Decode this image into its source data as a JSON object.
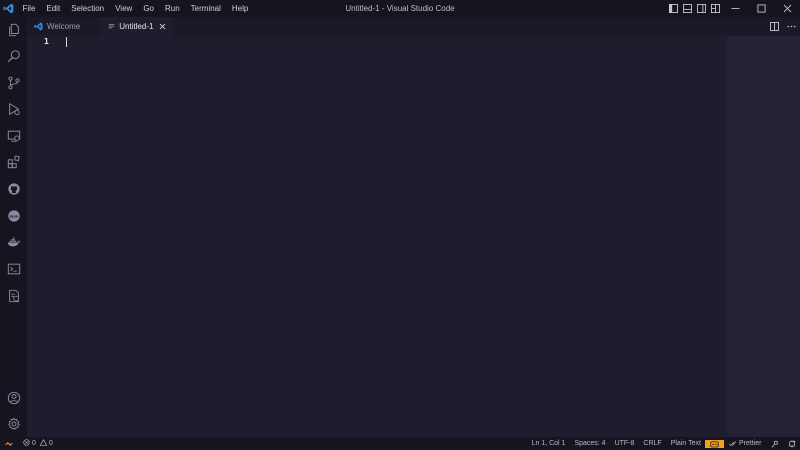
{
  "window": {
    "title": "Untitled-1 - Visual Studio Code"
  },
  "menu": {
    "items": [
      "File",
      "Edit",
      "Selection",
      "View",
      "Go",
      "Run",
      "Terminal",
      "Help"
    ]
  },
  "activity_bar": {
    "items": [
      "explorer-icon",
      "search-icon",
      "source-control-icon",
      "run-debug-icon",
      "remote-explorer-icon",
      "extensions-icon",
      "github-icon",
      "json-icon",
      "docker-icon",
      "terminal-icon",
      "test-report-icon"
    ],
    "bottom": [
      "account-icon",
      "settings-gear-icon"
    ]
  },
  "tabs": [
    {
      "label": "Welcome",
      "icon": "vscode-logo-icon",
      "active": false
    },
    {
      "label": "Untitled-1",
      "icon": "file-lines-icon",
      "active": true
    }
  ],
  "editor": {
    "line_numbers": [
      "1"
    ],
    "content": ""
  },
  "statusbar": {
    "errors": "0",
    "warnings": "0",
    "cursor_position": "Ln 1, Col 1",
    "indentation": "Spaces: 4",
    "encoding": "UTF-8",
    "eol": "CRLF",
    "language": "Plain Text",
    "formatter": "Prettier"
  },
  "colors": {
    "editor_bg": "#1e1d2e",
    "chrome_bg": "#16151f",
    "accent_logo": "#2f8de4",
    "status_highlight": "#f0a020"
  }
}
